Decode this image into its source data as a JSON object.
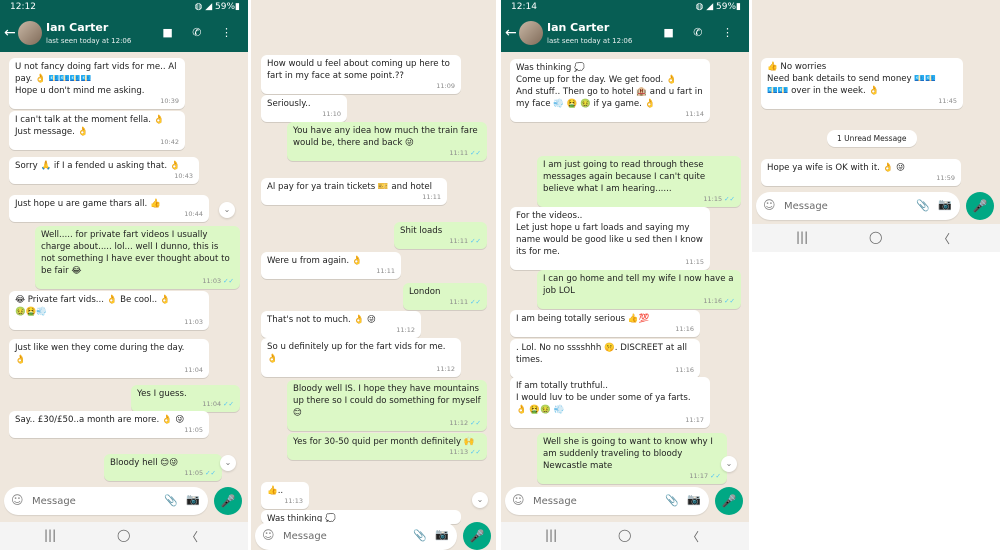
{
  "header": {
    "contact_name": "Ian Carter",
    "last_seen": "last seen today at 12:06",
    "back": "←",
    "icons": "■ ✆ ⋮"
  },
  "screens": [
    {
      "time": "12:12",
      "status_right": "◍ ◢ 59%▮",
      "messages": [
        {
          "dir": "in",
          "text": "U not fancy doing fart vids for me.. Al pay. 👌 💶💶💶💶\nHope u don't mind me asking.",
          "time": "10:39"
        },
        {
          "dir": "in",
          "text": "I can't talk at the moment fella. 👌\nJust message. 👌",
          "time": "10:42"
        },
        {
          "dir": "in",
          "text": "Sorry 🙏 if I a fended u asking that. 👌",
          "time": "10:43"
        },
        {
          "dir": "in",
          "text": "Just hope u are game thars all. 👍",
          "time": "10:44"
        },
        {
          "dir": "out",
          "text": "Well..... for private fart videos I usually charge about..... lol... well I dunno, this is not something I have ever thought about to be fair 😂",
          "time": "11:03",
          "ticks": "✓✓"
        },
        {
          "dir": "in",
          "text": "😂 Private fart vids... 👌 Be cool.. 👌\n🤢🤮💨",
          "time": "11:03"
        },
        {
          "dir": "in",
          "text": "Just like wen they come during the day.\n👌",
          "time": "11:04"
        },
        {
          "dir": "out",
          "text": "Yes I guess.",
          "time": "11:04",
          "ticks": "✓✓"
        },
        {
          "dir": "in",
          "text": "Say.. £30/£50..a month are more. 👌 😜",
          "time": "11:05"
        },
        {
          "dir": "out",
          "text": "Bloody hell 😊😜",
          "time": "11:05",
          "ticks": "✓✓"
        }
      ]
    },
    {
      "messages": [
        {
          "dir": "in",
          "text": "How would u feel about coming up here to fart in my face at some point.??",
          "time": "11:09"
        },
        {
          "dir": "in",
          "text": "Seriously..",
          "time": "11:10"
        },
        {
          "dir": "out",
          "text": "You have any idea how much the train fare would be, there and back 😜",
          "time": "11:11",
          "ticks": "✓✓"
        },
        {
          "dir": "in",
          "text": "Al pay for ya train tickets 🎫 and hotel",
          "time": "11:11"
        },
        {
          "dir": "out",
          "text": "Shit loads",
          "time": "11:11",
          "ticks": "✓✓"
        },
        {
          "dir": "in",
          "text": "Were u from again. 👌",
          "time": "11:11"
        },
        {
          "dir": "out",
          "text": "London",
          "time": "11:11",
          "ticks": "✓✓"
        },
        {
          "dir": "in",
          "text": "That's not to much. 👌 😜",
          "time": "11:12"
        },
        {
          "dir": "in",
          "text": "So u definitely up for the fart vids for me.\n👌",
          "time": "11:12"
        },
        {
          "dir": "out",
          "text": "Bloody well IS. I hope they have mountains up there so I could do something for myself 😊",
          "time": "11:12",
          "ticks": "✓✓"
        },
        {
          "dir": "out",
          "text": "Yes for 30-50 quid per month definitely 🙌",
          "time": "11:13",
          "ticks": "✓✓"
        },
        {
          "dir": "in",
          "text": "👍..",
          "time": "11:13"
        },
        {
          "dir": "in",
          "text": "Was thinking 💭",
          "time": ""
        }
      ]
    },
    {
      "time": "12:14",
      "status_right": "◍ ◢ 59%▮",
      "messages": [
        {
          "dir": "in",
          "text": "Was thinking 💭\nCome up for the day. We get food. 👌\nAnd stuff.. Then go to hotel 🏨 and u fart in my face 💨 🤮 🤢 if ya game. 👌",
          "time": "11:14"
        },
        {
          "dir": "out",
          "text": "I am just going to read through these messages again because I can't quite believe what I am hearing......",
          "time": "11:15",
          "ticks": "✓✓"
        },
        {
          "dir": "in",
          "text": "For the videos..\nLet just hope u fart loads and saying my name would be good like u sed then I know its for me.",
          "time": "11:15"
        },
        {
          "dir": "out",
          "text": "I can go home and tell my wife I now have a job LOL",
          "time": "11:16",
          "ticks": "✓✓"
        },
        {
          "dir": "in",
          "text": "I am being totally serious 👍💯",
          "time": "11:16"
        },
        {
          "dir": "in",
          "text": ". Lol. No no sssshhh 🤫. DISCREET at all times.",
          "time": "11:16"
        },
        {
          "dir": "in",
          "text": "If am totally truthful..\nI would luv to be under some of ya farts.\n👌 🤮🤢 💨",
          "time": "11:17"
        },
        {
          "dir": "out",
          "text": "Well she is going to want to know why I am suddenly traveling to bloody Newcastle mate",
          "time": "11:17",
          "ticks": "✓✓"
        }
      ]
    },
    {
      "messages": [
        {
          "dir": "in",
          "text": "👍 No worries\nNeed bank details to send money 💶💶\n💶💶 over in the week. 👌",
          "time": "11:45"
        },
        {
          "dir": "in",
          "text": "Hope ya wife is OK with it. 👌 😜",
          "time": "11:59"
        }
      ],
      "unread_label": "1 Unread Message"
    }
  ],
  "composer": {
    "placeholder": "Message",
    "emoji": "☺",
    "clip": "📎",
    "camera": "📷",
    "mic": "🎤"
  },
  "scroll_down": "⌄",
  "nav": {
    "recents": "|||",
    "home": "◯",
    "back": "〈"
  }
}
